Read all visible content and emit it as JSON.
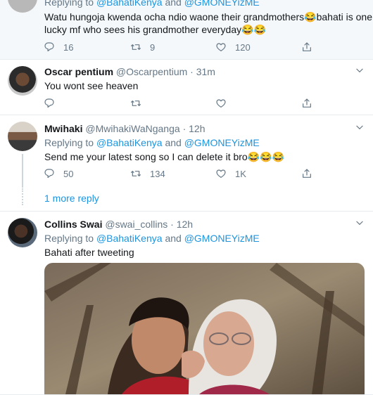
{
  "tweets": [
    {
      "replying_to": "Replying to",
      "mention_1": "@BahatiKenya",
      "and": "and",
      "mention_2": "@GMONEYizME",
      "text_line1": "Watu hungoja kwenda ocha ndio waone their grandmothers😂bahati is one",
      "text_line2": "lucky mf who sees his grandmother everyday😂😂",
      "replies": "16",
      "retweets": "9",
      "likes": "120"
    },
    {
      "name": "Oscar pentium",
      "handle": "@Oscarpentium",
      "sep": "·",
      "time": "31m",
      "text": "You wont see heaven"
    },
    {
      "name": "Mwihaki",
      "handle": "@MwihakiWaNganga",
      "sep": "·",
      "time": "12h",
      "replying_to": "Replying to",
      "mention_1": "@BahatiKenya",
      "and": "and",
      "mention_2": "@GMONEYizME",
      "text": "Send me your latest song so I can delete it bro😂😂😂",
      "replies": "50",
      "retweets": "134",
      "likes": "1K",
      "more_replies": "1 more reply"
    },
    {
      "name": "Collins Swai",
      "handle": "@swai_collins",
      "sep": "·",
      "time": "12h",
      "replying_to": "Replying to",
      "mention_1": "@BahatiKenya",
      "and": "and",
      "mention_2": "@GMONEYizME",
      "text": "Bahati after tweeting"
    }
  ],
  "icons": {
    "reply": "reply-icon",
    "retweet": "retweet-icon",
    "like": "heart-icon",
    "share": "share-icon",
    "caret": "chevron-down-icon"
  },
  "colors": {
    "link": "#1b95e0",
    "muted": "#657786",
    "border": "#e6ecf0"
  }
}
